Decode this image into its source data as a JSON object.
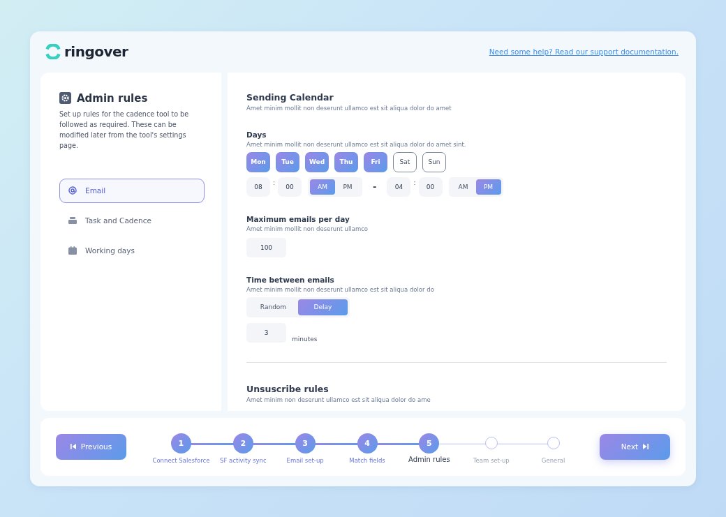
{
  "brand": {
    "name": "ringover"
  },
  "help_link": "Need some help? Read our support documentation.",
  "sidebar": {
    "title": "Admin rules",
    "description": "Set up rules for the cadence tool to be followed as required. These can be modified later from the tool's settings page.",
    "items": [
      {
        "label": "Email",
        "kind": "at",
        "selected": true
      },
      {
        "label": "Task and Cadence",
        "kind": "stack",
        "selected": false
      },
      {
        "label": "Working days",
        "kind": "calendar",
        "selected": false
      }
    ]
  },
  "sending_calendar": {
    "title": "Sending Calendar",
    "subtitle": "Amet minim mollit non deserunt ullamco est sit aliqua dolor do amet"
  },
  "days": {
    "title": "Days",
    "subtitle": "Amet minim mollit non deserunt ullamco est sit aliqua dolor do amet sint.",
    "items": [
      {
        "label": "Mon",
        "selected": true
      },
      {
        "label": "Tue",
        "selected": true
      },
      {
        "label": "Wed",
        "selected": true
      },
      {
        "label": "Thu",
        "selected": true
      },
      {
        "label": "Fri",
        "selected": true
      },
      {
        "label": "Sat",
        "selected": false
      },
      {
        "label": "Sun",
        "selected": false
      }
    ],
    "separator": "-",
    "times": [
      {
        "hour": "08",
        "colon": ":",
        "minute": "00",
        "periods": [
          {
            "label": "AM",
            "selected": true
          },
          {
            "label": "PM",
            "selected": false
          }
        ]
      },
      {
        "hour": "04",
        "colon": ":",
        "minute": "00",
        "periods": [
          {
            "label": "AM",
            "selected": false
          },
          {
            "label": "PM",
            "selected": true
          }
        ]
      }
    ]
  },
  "max_emails": {
    "title": "Maximum emails per day",
    "subtitle": "Amet minim mollit non deserunt ullamco",
    "value": "100"
  },
  "time_between": {
    "title": "Time between emails",
    "subtitle": "Amet minim mollit non deserunt ullamco est sit aliqua dolor do",
    "options": [
      {
        "label": "Random",
        "selected": false
      },
      {
        "label": "Delay",
        "selected": true
      }
    ],
    "value": "3",
    "unit": "minutes"
  },
  "unsubscribe": {
    "title": "Unsuscribe rules",
    "subtitle": "Amet minim non deserunt ullamco est sit aliqua dolor do ame"
  },
  "footer": {
    "previous": "Previous",
    "next": "Next",
    "steps": [
      {
        "number": "1",
        "label": "Connect Salesforce",
        "kind": "done"
      },
      {
        "number": "2",
        "label": "SF activity sync",
        "kind": "done"
      },
      {
        "number": "3",
        "label": "Email set-up",
        "kind": "done"
      },
      {
        "number": "4",
        "label": "Match fields",
        "kind": "done"
      },
      {
        "number": "5",
        "label": "Admin rules",
        "kind": "current"
      },
      {
        "label": "Team set-up",
        "kind": "todo"
      },
      {
        "label": "General",
        "kind": "todo"
      }
    ]
  }
}
